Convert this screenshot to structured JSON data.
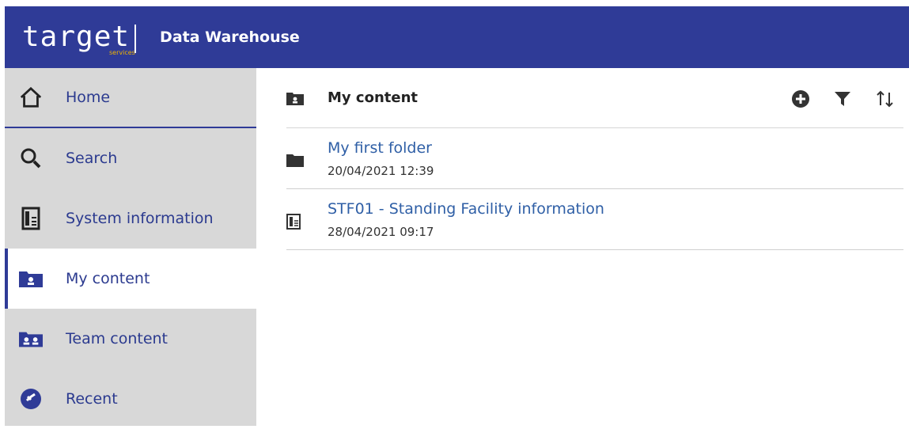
{
  "header": {
    "logo_word": "target",
    "logo_sub": "services",
    "title": "Data Warehouse",
    "background": "#2f3b97"
  },
  "sidebar": {
    "items": [
      {
        "label": "Home",
        "icon": "home-icon"
      },
      {
        "label": "Search",
        "icon": "search-icon"
      },
      {
        "label": "System information",
        "icon": "report-icon"
      },
      {
        "label": "My content",
        "icon": "personal-folder-icon",
        "active": true
      },
      {
        "label": "Team content",
        "icon": "team-folder-icon"
      },
      {
        "label": "Recent",
        "icon": "recent-icon"
      }
    ]
  },
  "main": {
    "title": "My content",
    "tools": [
      "add-icon",
      "filter-icon",
      "sort-icon"
    ],
    "items": [
      {
        "title": "My first folder",
        "date": "20/04/2021 12:39",
        "icon": "folder-icon"
      },
      {
        "title": "STF01 - Standing Facility information",
        "date": "28/04/2021 09:17",
        "icon": "report-icon"
      }
    ]
  }
}
